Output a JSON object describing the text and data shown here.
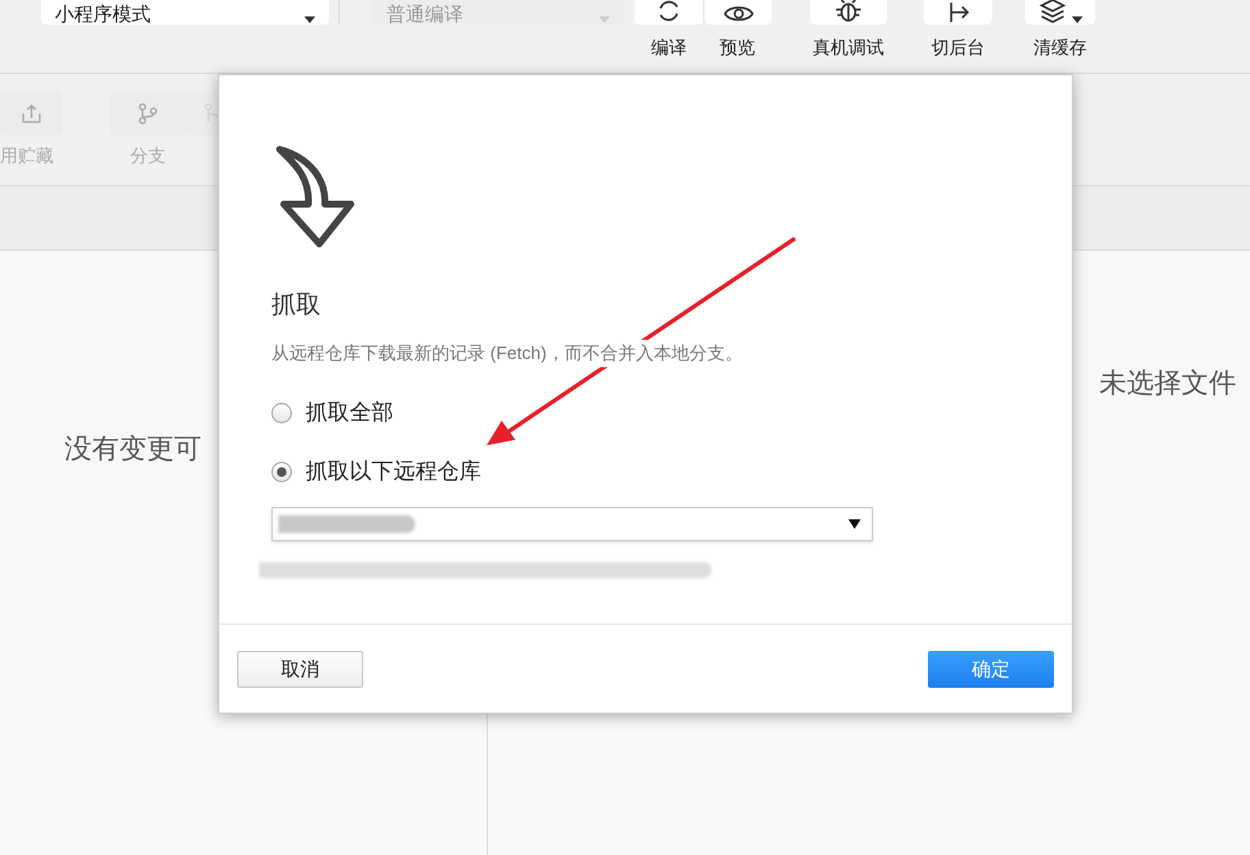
{
  "toolbar": {
    "mode_select": "小程序模式",
    "compile_select": {
      "value": "普通编译",
      "disabled": true
    },
    "buttons": [
      {
        "kind": "compile",
        "label": "编译"
      },
      {
        "kind": "preview",
        "label": "预览"
      },
      {
        "kind": "debug",
        "label": "真机调试"
      },
      {
        "kind": "background",
        "label": "切后台"
      },
      {
        "kind": "cache",
        "label": "清缓存"
      }
    ]
  },
  "git_toolbar": [
    {
      "kind": "stash",
      "label": "用贮藏"
    },
    {
      "kind": "branch",
      "label": "分支"
    }
  ],
  "changes_panel": {
    "message": "没有变更可"
  },
  "file_panel": {
    "message": "未选择文件"
  },
  "dialog": {
    "title": "抓取",
    "description": "从远程仓库下载最新的记录 (Fetch)，而不合并入本地分支。",
    "options": [
      {
        "label": "抓取全部",
        "selected": false
      },
      {
        "label": "抓取以下远程仓库",
        "selected": true
      }
    ],
    "cancel": "取消",
    "confirm": "确定"
  }
}
